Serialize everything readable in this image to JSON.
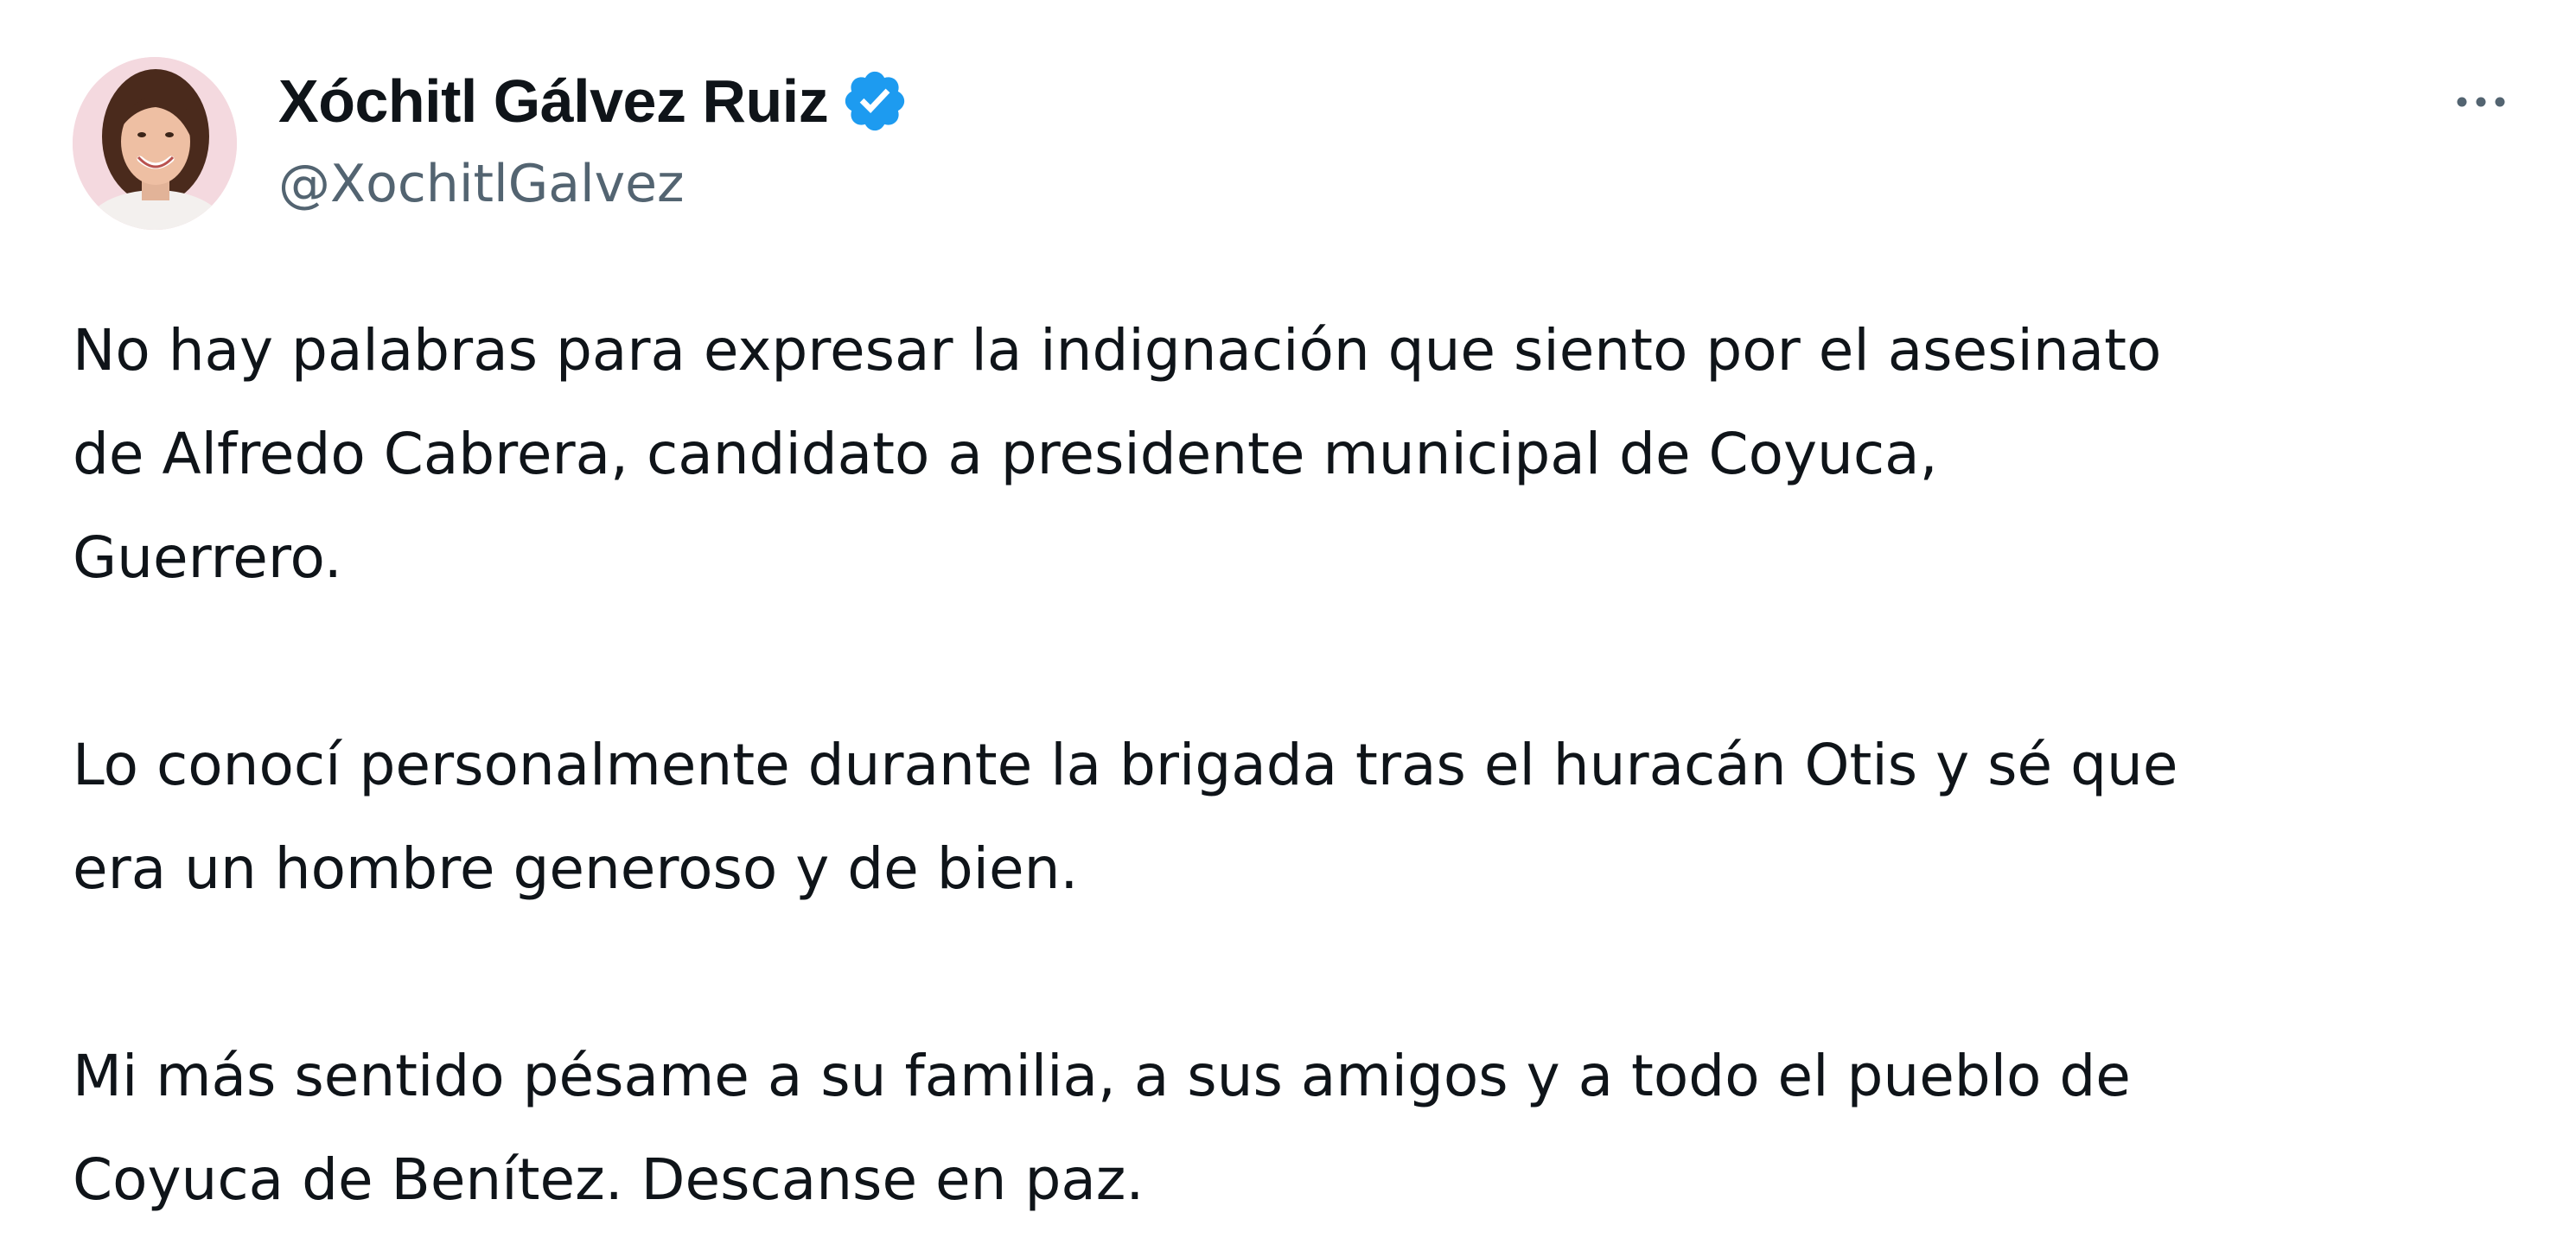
{
  "author": {
    "display_name": "Xóchitl Gálvez Ruiz",
    "handle": "@XochitlGalvez",
    "verified": true,
    "verified_color": "#1d9bf0"
  },
  "icons": {
    "verified": "verified-badge-icon",
    "more": "more-horizontal-icon"
  },
  "tweet": {
    "paragraphs": [
      {
        "lines": [
          "No hay palabras para expresar la indignación que siento por el asesinato",
          "de Alfredo Cabrera, candidato a presidente municipal de Coyuca,",
          "Guerrero."
        ]
      },
      {
        "lines": [
          "Lo conocí personalmente durante la brigada tras el huracán Otis y sé que",
          "era un hombre generoso y de bien."
        ]
      },
      {
        "lines": [
          "Mi más sentido pésame a su familia, a sus amigos y a todo el pueblo de",
          "Coyuca de Benítez. Descanse en paz."
        ]
      }
    ]
  },
  "colors": {
    "text": "#0f1419",
    "secondary_text": "#536471",
    "accent": "#1d9bf0",
    "background": "#ffffff"
  }
}
